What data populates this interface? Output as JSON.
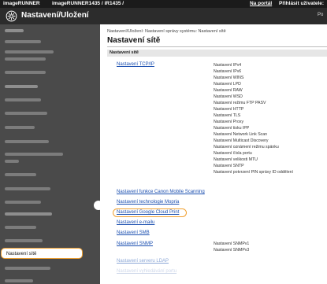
{
  "topbar": {
    "brand": "imageRUNNER",
    "model": "imageRUNNER1435 / iR1435 /",
    "portal_link": "Na portál",
    "login": "Přihlásit uživatele:"
  },
  "header": {
    "title": "Nastavení/Uložení",
    "right_text": "Po"
  },
  "sidebar": {
    "active_label": "Nastavení sítě"
  },
  "main": {
    "breadcrumb": "Nastavení/Uložení: Nastavení správy systému: Nastavení sítě",
    "page_title": "Nastavení sítě",
    "section_header": "Nastavení sítě",
    "links": {
      "tcpip": "Nastavení TCP/IP",
      "canon_mobile": "Nastavení funkce Canon Mobile Scanning",
      "mopria": "Nastavení technologie Mopria",
      "google_cloud": "Nastavení Google Cloud Print",
      "email": "Nastavení e-mailu",
      "smb": "Nastavení SMB",
      "snmp": "Nastavení SNMP",
      "ldap": "Nastavení serveru LDAP",
      "more": "Nastavení vyhledávání portu"
    },
    "tcpip_items": [
      "Nastavení IPv4",
      "Nastavení IPv6",
      "Nastavení WINS",
      "Nastavení LPD",
      "Nastavení RAW",
      "Nastavení WSD",
      "Nastavení režimu FTP PASV",
      "Nastavení HTTP",
      "Nastavení TLS",
      "Nastavení Proxy",
      "Nastavení tisku IPP",
      "Nastavení Network Link Scan",
      "Nastavení Multicast Discovery",
      "Nastavení oznámení režimu spánku",
      "Nastavení čísla portu",
      "Nastavení velikosti MTU",
      "Nastavení SNTP",
      "Nastavení potvrzení PIN správy ID oddělení"
    ],
    "snmp_items": [
      "Nastavení SNMPv1",
      "Nastavení SNMPv3"
    ]
  },
  "colors": {
    "accent_highlight": "#f0a030",
    "link": "#1b4fb0",
    "sidebar_bg": "#4a4a4a",
    "header_bg": "#2c2c2c"
  }
}
